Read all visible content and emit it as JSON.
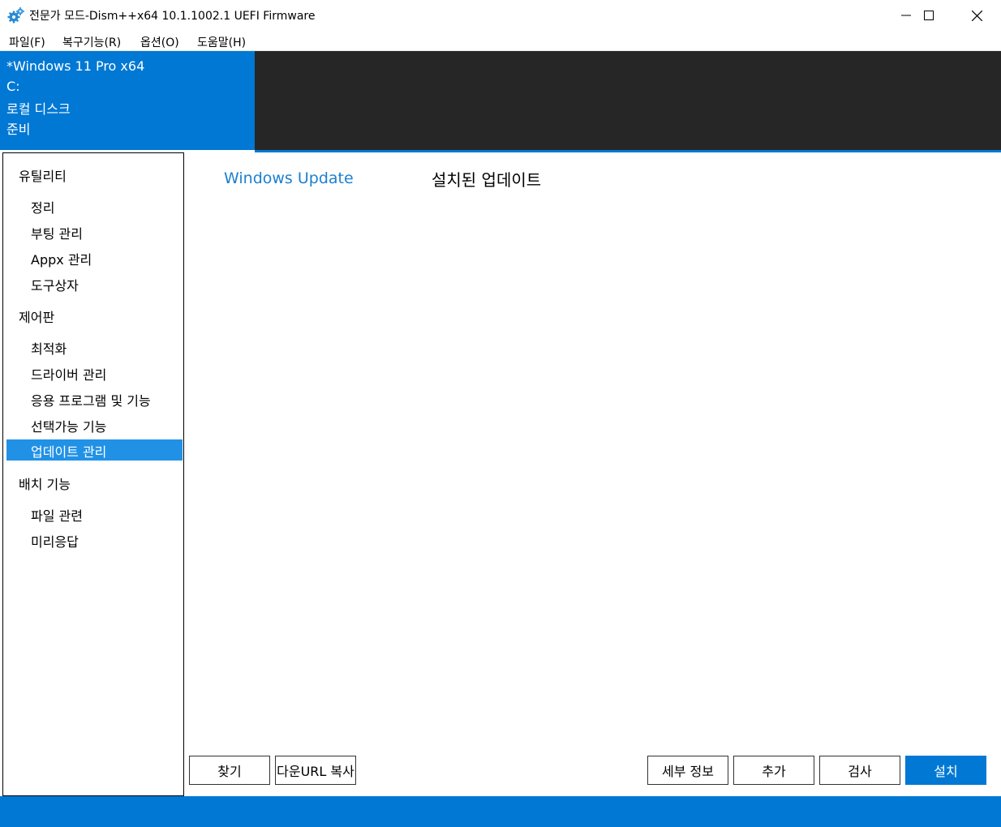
{
  "window": {
    "title": "전문가 모드-Dism++x64 10.1.1002.1 UEFI Firmware",
    "icon": "gears-icon",
    "controls": [
      "minimize-icon",
      "maximize-icon",
      "close-icon"
    ]
  },
  "menu": {
    "file": "파일(F)",
    "restore": "복구기능(R)",
    "options": "옵션(O)",
    "help": "도움말(H)"
  },
  "image_info": {
    "name": "*Windows 11 Pro x64",
    "drive": "C:",
    "volume": "로컬 디스크",
    "status": "준비"
  },
  "sidebar": {
    "utilities": "유틸리티",
    "utility_items": [
      "정리",
      "부팅 관리",
      "Appx 관리",
      "도구상자"
    ],
    "control_panel": "제어판",
    "control_items": [
      "최적화",
      "드라이버 관리",
      "응용 프로그램 및 기능",
      "선택가능 기능",
      "업데이트 관리"
    ],
    "deploy": "배치 기능",
    "deploy_items": [
      "파일 관련",
      "미리응답"
    ],
    "selected": "업데이트 관리"
  },
  "tabs": {
    "active": "Windows Update",
    "inactive": "설치된 업데이트"
  },
  "buttons": {
    "find": "찾기",
    "copy_url": "다운URL 복사",
    "details": "세부 정보",
    "add": "추가",
    "scan": "검사",
    "install": "설치"
  },
  "colors": {
    "accent": "#0078d4",
    "selected": "#2191e6",
    "dark_panel": "#262626",
    "tab_active": "#1b7fd0"
  }
}
